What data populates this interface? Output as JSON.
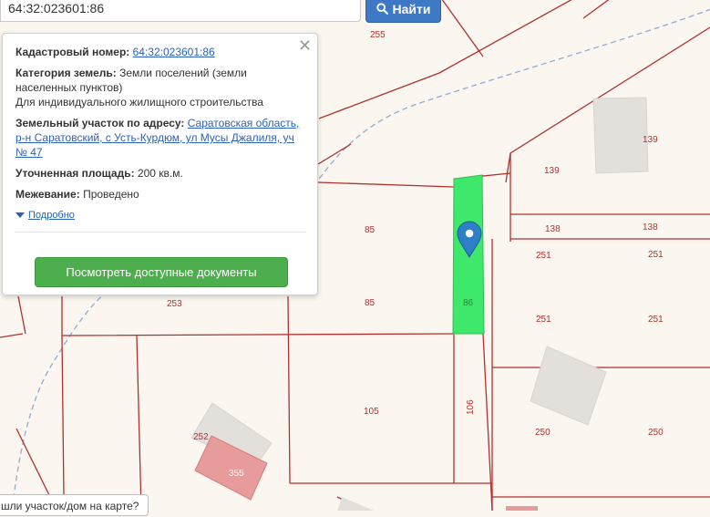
{
  "search": {
    "query": "64:32:023601:86",
    "button_label": "Найти"
  },
  "popup": {
    "cadastral_label": "Кадастровый номер:",
    "cadastral_value": "64:32:023601:86",
    "category_label": "Категория земель:",
    "category_value": "Земли поселений (земли населенных пунктов)",
    "category_use": "Для индивидуального жилищного строительства",
    "address_label": "Земельный участок по адресу:",
    "address_value": "Саратовская область, р-н Саратовский, с Усть-Курдюм, ул Мусы Джалиля, уч № 47",
    "area_label": "Уточненная площадь:",
    "area_value": "200 кв.м.",
    "survey_label": "Межевание:",
    "survey_value": "Проведено",
    "more_label": "Подробно",
    "docs_button": "Посмотреть доступные документы"
  },
  "map": {
    "plot_labels": [
      "255",
      "139",
      "139",
      "138",
      "138",
      "85",
      "85",
      "86",
      "253",
      "251",
      "251",
      "251",
      "251",
      "105",
      "106",
      "252",
      "355",
      "250",
      "250"
    ],
    "selected_plot_color": "#3ee86a",
    "boundary_color": "#b0302e",
    "building_color": "#e3e0dc",
    "highlighted_building_color": "#e79b9b"
  },
  "hint": {
    "text": "шли участок/дом на карте?"
  }
}
